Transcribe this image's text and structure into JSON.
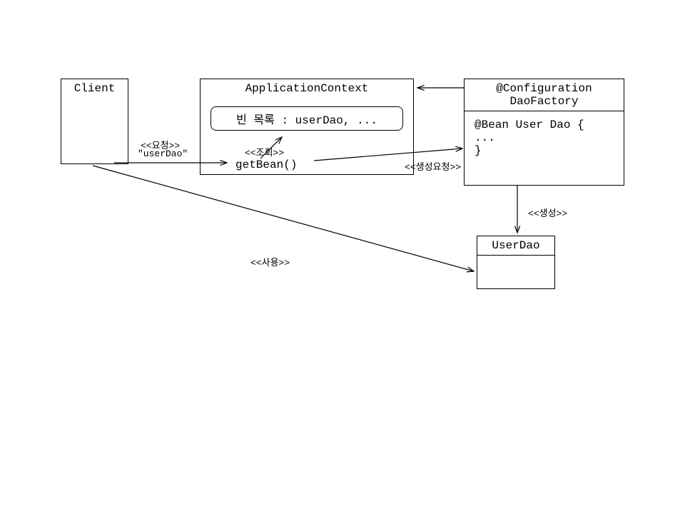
{
  "client": {
    "title": "Client"
  },
  "appContext": {
    "title": "ApplicationContext",
    "beanList": "빈 목록 : userDao, ...",
    "method": "getBean()"
  },
  "daoFactory": {
    "line1": "@Configuration",
    "line2": "DaoFactory",
    "body1": "@Bean User Dao {",
    "body2": "...",
    "body3": "}"
  },
  "userDao": {
    "title": "UserDao"
  },
  "labels": {
    "request": "<<요청>>",
    "requestArg": "\"userDao\"",
    "lookup": "<<조회>>",
    "createReq": "<<생성요청>>",
    "create": "<<생성>>",
    "use": "<<사용>>"
  }
}
